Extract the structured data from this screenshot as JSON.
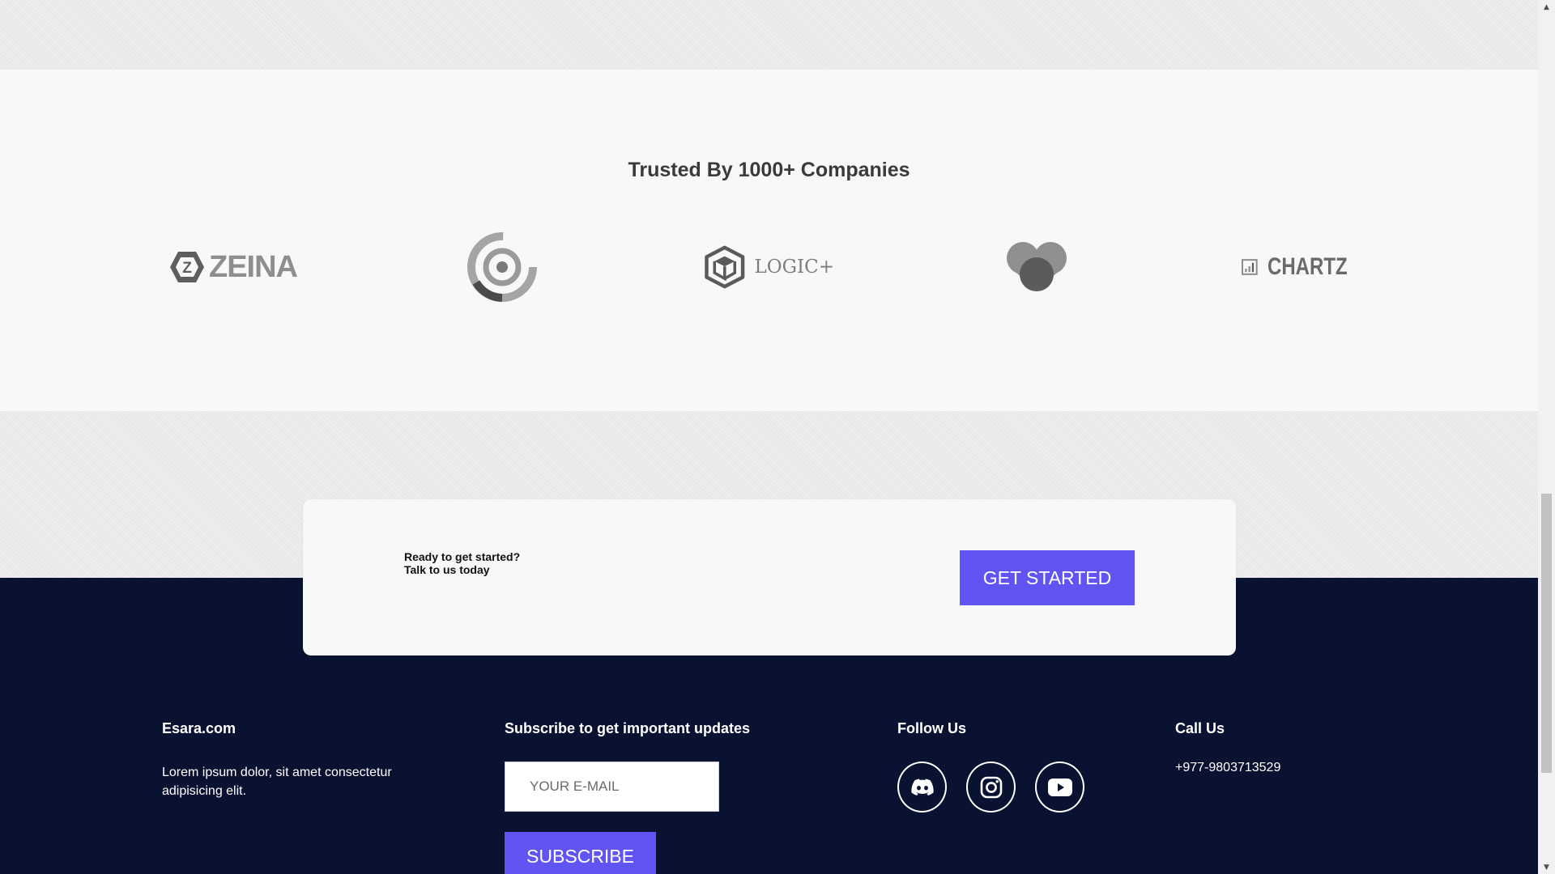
{
  "trusted": {
    "title": "Trusted By 1000+ Companies",
    "logos": [
      {
        "name": "zeina-logo",
        "text": "ZEINA",
        "badge": "Z"
      },
      {
        "name": "target-logo"
      },
      {
        "name": "logic-plus-logo",
        "text": "LOGIC+"
      },
      {
        "name": "heart-logo"
      },
      {
        "name": "chartz-logo",
        "text": "CHARTZ"
      }
    ]
  },
  "cta": {
    "line1": "Ready to get started?",
    "line2": "Talk to us today",
    "button_label": "GET STARTED"
  },
  "footer": {
    "brand": {
      "title": "Esara.com",
      "description": "Lorem ipsum dolor, sit amet consectetur adipisicing elit."
    },
    "subscribe": {
      "title": "Subscribe to get important updates",
      "email_placeholder": "YOUR E-MAIL",
      "button_label": "SUBSCRIBE"
    },
    "follow": {
      "title": "Follow Us",
      "icons": [
        "discord-icon",
        "instagram-icon",
        "youtube-icon"
      ]
    },
    "call": {
      "title": "Call Us",
      "phone": "+977-9803713529"
    }
  },
  "colors": {
    "accent": "#6055f2",
    "footer_bg": "#0a1232",
    "section_bg": "#f7f8fa",
    "logo_gray": "#8e8e8e"
  },
  "scrollbar": {
    "up_arrow_icon": "arrow-up-icon",
    "down_arrow_icon": "arrow-down-icon"
  }
}
